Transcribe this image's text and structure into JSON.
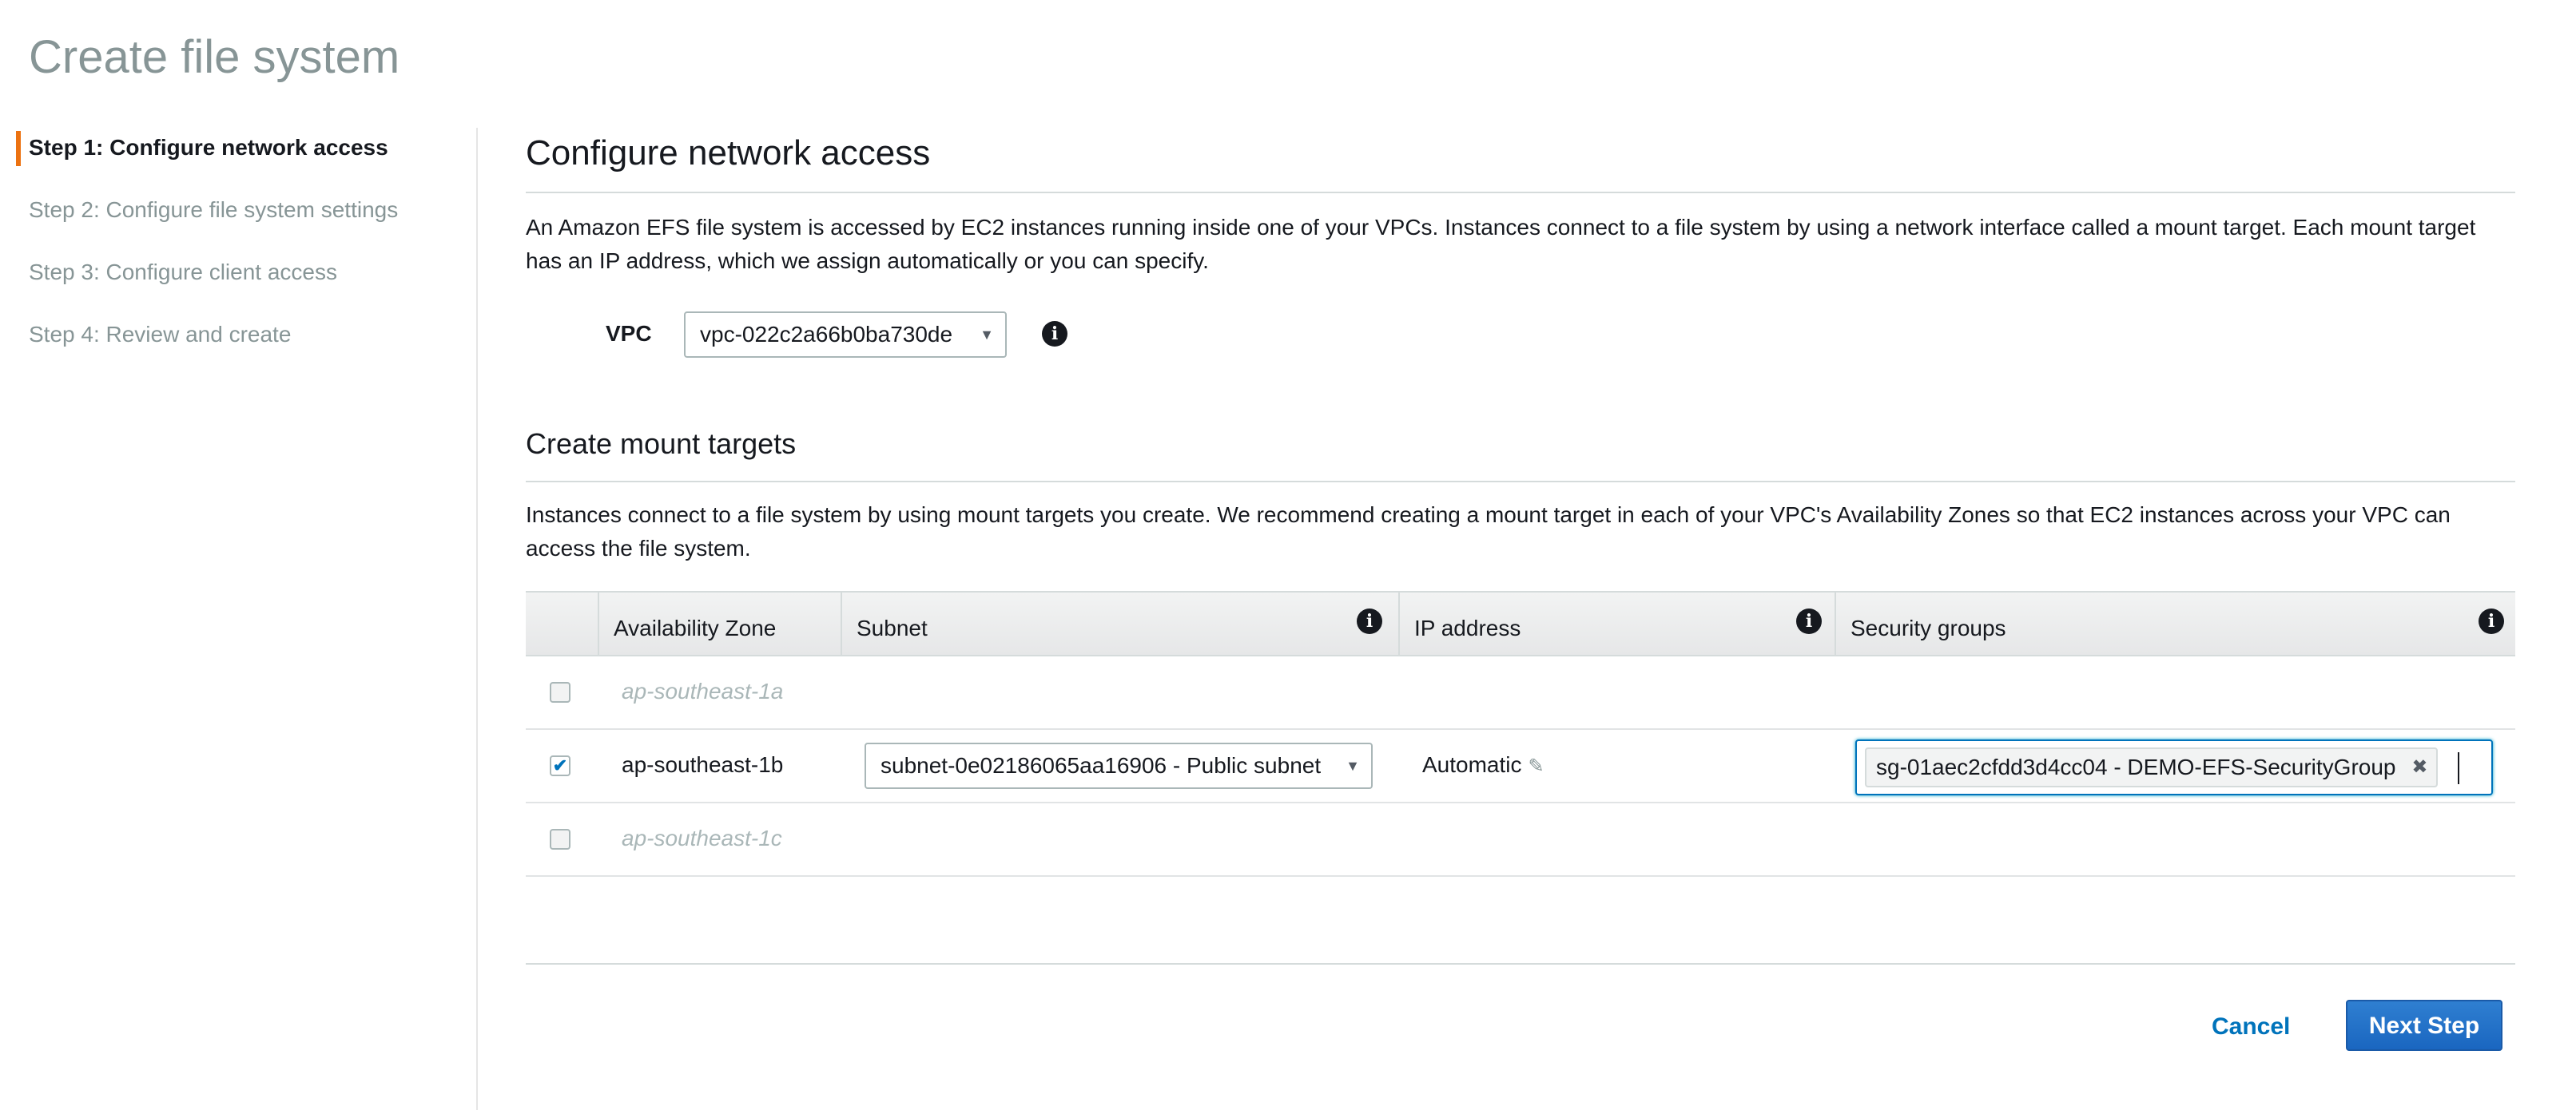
{
  "page": {
    "title": "Create file system"
  },
  "sidebar": {
    "steps": [
      {
        "label": "Step 1: Configure network access",
        "active": true
      },
      {
        "label": "Step 2: Configure file system settings",
        "active": false
      },
      {
        "label": "Step 3: Configure client access",
        "active": false
      },
      {
        "label": "Step 4: Review and create",
        "active": false
      }
    ]
  },
  "network": {
    "heading": "Configure network access",
    "description": "An Amazon EFS file system is accessed by EC2 instances running inside one of your VPCs. Instances connect to a file system by using a network interface called a mount target. Each mount target has an IP address, which we assign automatically or you can specify.",
    "vpc_label": "VPC",
    "vpc_value": "vpc-022c2a66b0ba730de"
  },
  "mount_targets": {
    "heading": "Create mount targets",
    "description": "Instances connect to a file system by using mount targets you create. We recommend creating a mount target in each of your VPC's Availability Zones so that EC2 instances across your VPC can access the file system.",
    "columns": {
      "az": "Availability Zone",
      "subnet": "Subnet",
      "ip": "IP address",
      "sg": "Security groups"
    },
    "rows": [
      {
        "az": "ap-southeast-1a",
        "checked": false
      },
      {
        "az": "ap-southeast-1b",
        "checked": true,
        "subnet": "subnet-0e02186065aa16906 - Public subnet",
        "ip": "Automatic",
        "sg": "sg-01aec2cfdd3d4cc04 - DEMO-EFS-SecurityGroup"
      },
      {
        "az": "ap-southeast-1c",
        "checked": false
      }
    ]
  },
  "actions": {
    "cancel": "Cancel",
    "next": "Next Step"
  },
  "icons": {
    "info": "info-icon",
    "caret": "chevron-down-icon",
    "edit": "pencil-icon",
    "remove": "close-icon",
    "check": "checkmark-icon"
  },
  "colors": {
    "accent": "#ec7211",
    "link": "#0073bb",
    "primary_button": "#1a66c0"
  }
}
